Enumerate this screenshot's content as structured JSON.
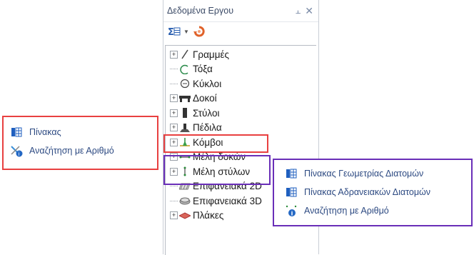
{
  "panel": {
    "title": "Δεδομένα Εργου",
    "pin_icon": "pin-icon",
    "close_icon": "close-icon",
    "toolbar_icons": [
      "sigma-grid-icon",
      "dropdown-arrow-icon",
      "refresh-icon"
    ]
  },
  "tree": {
    "items": [
      {
        "label": "Γραμμές",
        "icon": "line-icon",
        "expandable": true
      },
      {
        "label": "Τόξα",
        "icon": "arc-icon",
        "expandable": false
      },
      {
        "label": "Κύκλοι",
        "icon": "circle-icon",
        "expandable": false
      },
      {
        "label": "Δοκοί",
        "icon": "beam-icon",
        "expandable": true
      },
      {
        "label": "Στύλοι",
        "icon": "column-icon",
        "expandable": true
      },
      {
        "label": "Πέδιλα",
        "icon": "footing-icon",
        "expandable": true
      },
      {
        "label": "Κόμβοι",
        "icon": "node-icon",
        "expandable": true
      },
      {
        "label": "Μέλη δοκών",
        "icon": "beam-member-icon",
        "expandable": true
      },
      {
        "label": "Μέλη στύλων",
        "icon": "column-member-icon",
        "expandable": true
      },
      {
        "label": "Επιφανειακά 2D",
        "icon": "surface-2d-icon",
        "expandable": false
      },
      {
        "label": "Επιφανειακά 3D",
        "icon": "surface-3d-icon",
        "expandable": false
      },
      {
        "label": "Πλάκες",
        "icon": "slab-icon",
        "expandable": true
      }
    ]
  },
  "left_menu": {
    "items": [
      {
        "label": "Πίνακας",
        "icon": "table-icon"
      },
      {
        "label": "Αναζήτηση με Αριθμό",
        "icon": "search-by-number-icon"
      }
    ]
  },
  "right_menu": {
    "items": [
      {
        "label": "Πίνακας Γεωμετρίας Διατομών",
        "icon": "table-icon"
      },
      {
        "label": "Πίνακας Αδρανειακών Διατομών",
        "icon": "table-icon"
      },
      {
        "label": "Αναζήτηση με Αριθμό",
        "icon": "info-search-icon"
      }
    ]
  },
  "colors": {
    "highlight_red": "#e84040",
    "highlight_purple": "#6a2fb8",
    "menu_text": "#2d4a82"
  }
}
